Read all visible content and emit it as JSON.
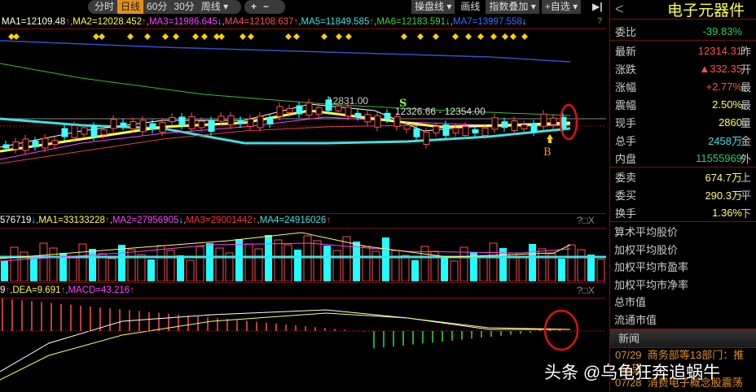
{
  "toolbar": {
    "periods": [
      "分时",
      "日线",
      "60分",
      "30分",
      "周线 ▾"
    ],
    "active": 1,
    "zoom_in": "+",
    "zoom_out": "−",
    "right_buttons": [
      "操盘线 ▾",
      "画线",
      "指数叠加 ▾",
      "+自选 ▾"
    ],
    "collapse": "▶|"
  },
  "main_legend": [
    {
      "t": "MA1=12109.48",
      "c": "#ffffff",
      "a": "↑"
    },
    {
      "t": "MA2=12028.452",
      "c": "#ffff40",
      "a": "↑"
    },
    {
      "t": "MA3=11986.645",
      "c": "#ff40ff",
      "a": "↓"
    },
    {
      "t": "MA4=12108.637",
      "c": "#ff5050",
      "a": "↑"
    },
    {
      "t": "MA5=11849.585",
      "c": "#40e0e0",
      "a": "↑"
    },
    {
      "t": "MA6=12183.591",
      "c": "#40d040",
      "a": "↓"
    },
    {
      "t": "MA7=13997.558",
      "c": "#3070ff",
      "a": "↓"
    }
  ],
  "main_annotations": {
    "high": "12831.00",
    "range": "12326.66 - 12354.00",
    "sell": "S",
    "buy": "B"
  },
  "vol_legend": [
    {
      "t": "576719",
      "c": "#ffffff",
      "a": "↓"
    },
    {
      "t": "MA1=33133228",
      "c": "#ffff40",
      "a": "↑"
    },
    {
      "t": "MA2=27956905",
      "c": "#ff40ff",
      "a": "↓"
    },
    {
      "t": "MA3=29001442",
      "c": "#ff3030",
      "a": "↑"
    },
    {
      "t": "MA4=24916026",
      "c": "#40e0e0",
      "a": "↑"
    }
  ],
  "macd_legend": [
    {
      "t": "9",
      "c": "#ffffff",
      "a": "↑"
    },
    {
      "t": "DEA=9.691",
      "c": "#ffff40",
      "a": "↑"
    },
    {
      "t": "MACD=43.216",
      "c": "#ff40ff",
      "a": "↑"
    }
  ],
  "help": "?",
  "panel_btns": "?□X",
  "quote": {
    "back": "<",
    "title": "电子元器件",
    "rows1": [
      {
        "k": "委比",
        "v": "-39.83%",
        "c": "#20d060"
      }
    ],
    "rows2": [
      {
        "k": "最新",
        "v": "12314.31",
        "c": "#ff5050",
        "r": "昨"
      },
      {
        "k": "涨跌",
        "v": "▲332.35",
        "c": "#ff5050",
        "r": "开"
      },
      {
        "k": "涨幅",
        "v": "+2.77%",
        "c": "#ff5050",
        "r": "最"
      },
      {
        "k": "震幅",
        "v": "2.50%",
        "c": "#ffff60",
        "r": "最"
      },
      {
        "k": "现手",
        "v": "2860",
        "c": "#ffff60",
        "r": "量"
      },
      {
        "k": "总手",
        "v": "2458万",
        "c": "#40e0e0",
        "r": "金"
      },
      {
        "k": "内盘",
        "v": "11555969",
        "c": "#20d060",
        "r": "外"
      }
    ],
    "rows3": [
      {
        "k": "委卖",
        "v": "674.7万",
        "c": "#ffff60",
        "r": "上"
      },
      {
        "k": "委买",
        "v": "290.3万",
        "c": "#ffff60",
        "r": "平"
      },
      {
        "k": "换手",
        "v": "1.36%",
        "c": "#ffff60",
        "r": "下"
      }
    ],
    "stats": [
      "算术平均股价",
      "加权平均股价",
      "加权平均市盈率",
      "加权平均市净率",
      "总市值",
      "流通市值"
    ],
    "news_title": "新闻",
    "news": [
      {
        "d": "07/29",
        "t": "商务部等13部门：推"
      },
      {
        "d": "",
        "t": "与望"
      },
      {
        "d": "07/28",
        "t": "消费电子概念股震荡"
      }
    ]
  },
  "watermark": "头条 @乌龟狂奔追蜗牛"
}
